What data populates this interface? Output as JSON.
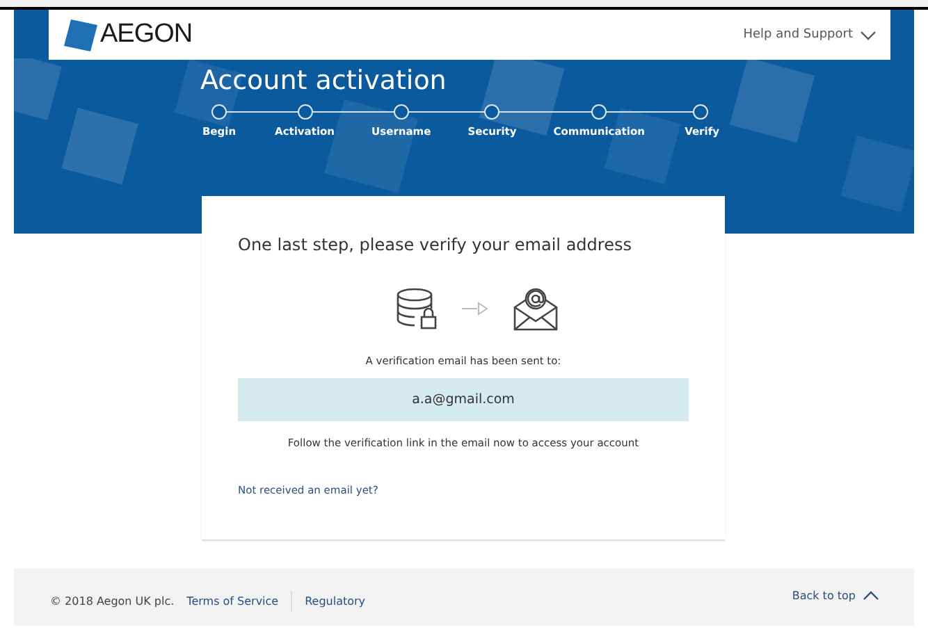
{
  "header": {
    "logo": "AEGON",
    "help_menu": "Help and Support"
  },
  "title": "Account activation",
  "steps": [
    {
      "label": "Begin"
    },
    {
      "label": "Activation"
    },
    {
      "label": "Username"
    },
    {
      "label": "Security"
    },
    {
      "label": "Communication"
    },
    {
      "label": "Verify"
    }
  ],
  "card": {
    "heading": "One last step, please verify your email address",
    "sent_text": "A verification email has been sent to:",
    "email": "a.a@gmail.com",
    "instruction": "Follow the verification link in the email now to access your account",
    "resend_link": "Not received an email yet?"
  },
  "footer": {
    "copyright": "© 2018 Aegon UK plc.",
    "links": [
      "Terms of Service",
      "Regulatory"
    ],
    "back_to_top": "Back to top"
  }
}
